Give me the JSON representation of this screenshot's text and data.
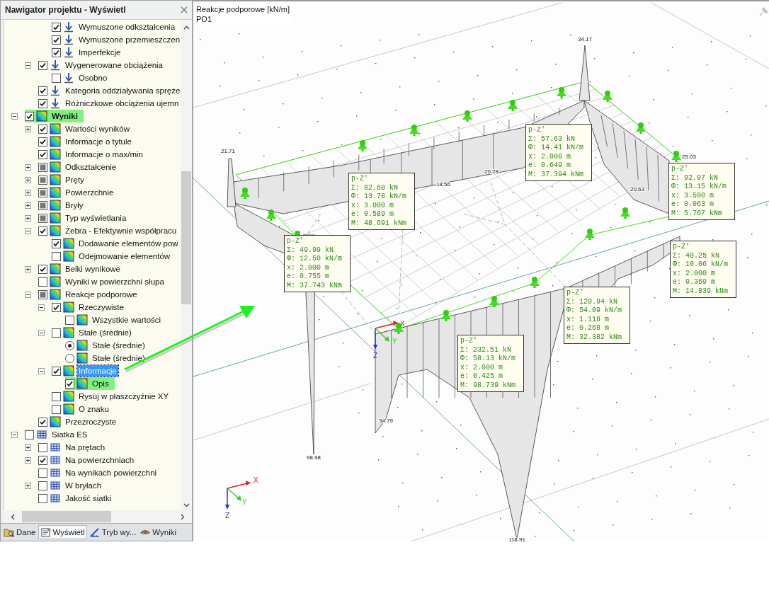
{
  "navigator": {
    "title": "Nawigator projektu - Wyświetl"
  },
  "tree": [
    {
      "children": [
        {
          "children": [
            {
              "label": "Wymuszone odkształcenia",
              "kind": "checkbox",
              "checked": true,
              "selected": false,
              "highlighted": false
            },
            {
              "label": "Wymuszone przemieszczen",
              "kind": "checkbox",
              "checked": true,
              "selected": false,
              "highlighted": false
            },
            {
              "label": "Imperfekcje",
              "kind": "checkbox",
              "checked": true,
              "selected": false,
              "highlighted": false
            }
          ]
        },
        {
          "label": "Wygenerowane obciążenia",
          "kind": "checkbox",
          "checked": true,
          "selected": false,
          "highlighted": false,
          "expanded": true,
          "children": [
            {
              "label": "Osobno",
              "kind": "checkbox",
              "checked": false,
              "selected": false,
              "highlighted": false
            }
          ]
        },
        {
          "label": "Kategoria oddziaływania spręże",
          "kind": "checkbox",
          "checked": true,
          "selected": false,
          "highlighted": false
        },
        {
          "label": "Różniczkowe obciążenia ujemn",
          "kind": "checkbox",
          "checked": true,
          "selected": false,
          "highlighted": false
        }
      ]
    },
    {
      "label": "Wyniki",
      "bold": true,
      "kind": "checkbox",
      "checked": true,
      "selected": false,
      "highlighted": true,
      "expanded": true,
      "children": [
        {
          "label": "Wartości wyników",
          "kind": "checkbox",
          "checked": true,
          "selected": false,
          "highlighted": false,
          "expanded": false
        },
        {
          "label": "Informacje o tytule",
          "kind": "checkbox",
          "checked": true,
          "selected": false,
          "highlighted": false
        },
        {
          "label": "Informacje o max/min",
          "kind": "checkbox",
          "checked": true,
          "selected": false,
          "highlighted": false
        },
        {
          "label": "Odkształcenie",
          "kind": "checkbox",
          "checked": false,
          "partial": true,
          "selected": false,
          "highlighted": false,
          "expanded": false
        },
        {
          "label": "Pręty",
          "kind": "checkbox",
          "checked": false,
          "partial": true,
          "selected": false,
          "highlighted": false,
          "expanded": false
        },
        {
          "label": "Powierzchnie",
          "kind": "checkbox",
          "checked": false,
          "partial": true,
          "selected": false,
          "highlighted": false,
          "expanded": false
        },
        {
          "label": "Bryły",
          "kind": "checkbox",
          "checked": false,
          "partial": true,
          "selected": false,
          "highlighted": false,
          "expanded": false
        },
        {
          "label": "Typ wyświetlania",
          "kind": "checkbox",
          "checked": false,
          "partial": true,
          "selected": false,
          "highlighted": false,
          "expanded": false
        },
        {
          "label": "Żebra - Efektywnie współpracu",
          "kind": "checkbox",
          "checked": true,
          "selected": false,
          "highlighted": false,
          "expanded": true,
          "children": [
            {
              "label": "Dodawanie elementów pow",
              "kind": "checkbox",
              "checked": true,
              "selected": false,
              "highlighted": false
            },
            {
              "label": "Odejmowanie elementów",
              "kind": "checkbox",
              "checked": false,
              "selected": false,
              "highlighted": false
            }
          ]
        },
        {
          "label": "Belki wynikowe",
          "kind": "checkbox",
          "checked": true,
          "selected": false,
          "highlighted": false,
          "expanded": false
        },
        {
          "label": "Wyniki w powierzchni słupa",
          "kind": "checkbox",
          "checked": false,
          "selected": false,
          "highlighted": false
        },
        {
          "label": "Reakcje podporowe",
          "kind": "checkbox",
          "checked": false,
          "partial": true,
          "selected": false,
          "highlighted": false,
          "expanded": true,
          "children": [
            {
              "label": "Rzeczywiste",
              "kind": "checkbox",
              "checked": true,
              "selected": false,
              "highlighted": false,
              "expanded": true,
              "children": [
                {
                  "label": "Wszystkie wartości",
                  "kind": "checkbox",
                  "checked": false,
                  "selected": false,
                  "highlighted": false
                }
              ]
            },
            {
              "label": "Stałe (średnie)",
              "kind": "checkbox",
              "checked": false,
              "selected": false,
              "highlighted": false,
              "expanded": true,
              "children": [
                {
                  "label": "Stałe (średnie)",
                  "kind": "radio",
                  "checked": true,
                  "selected": false,
                  "highlighted": false
                },
                {
                  "label": "Stałe (średnie)",
                  "kind": "radio",
                  "checked": false,
                  "selected": false,
                  "highlighted": false
                }
              ]
            },
            {
              "label": "Informacje",
              "kind": "checkbox",
              "checked": true,
              "selected": true,
              "highlighted": false,
              "expanded": true,
              "children": [
                {
                  "label": "Opis",
                  "kind": "checkbox",
                  "checked": true,
                  "selected": false,
                  "highlighted": true
                }
              ]
            },
            {
              "label": "Rysuj w płaszczyźnie XY",
              "kind": "checkbox",
              "checked": false,
              "selected": false,
              "highlighted": false
            },
            {
              "label": "O znaku",
              "kind": "checkbox",
              "checked": false,
              "selected": false,
              "highlighted": false
            }
          ]
        },
        {
          "label": "Przezroczyste",
          "kind": "checkbox",
          "checked": true,
          "selected": false,
          "highlighted": false
        }
      ]
    },
    {
      "label": "Siatka ES",
      "kind": "checkbox",
      "checked": false,
      "selected": false,
      "highlighted": false,
      "expanded": true,
      "children": [
        {
          "label": "Na prętach",
          "kind": "checkbox",
          "checked": false,
          "selected": false,
          "highlighted": false,
          "expanded": false
        },
        {
          "label": "Na powierzchniach",
          "kind": "checkbox",
          "checked": true,
          "selected": false,
          "highlighted": false,
          "expanded": false
        },
        {
          "label": "Na wynikach powierzchni",
          "kind": "checkbox",
          "checked": false,
          "selected": false,
          "highlighted": false
        },
        {
          "label": "W bryłach",
          "kind": "checkbox",
          "checked": false,
          "selected": false,
          "highlighted": false,
          "expanded": false
        },
        {
          "label": "Jakość siatki",
          "kind": "checkbox",
          "checked": false,
          "selected": false,
          "highlighted": false
        }
      ]
    }
  ],
  "tabs": [
    {
      "label": "Dane",
      "selected": false
    },
    {
      "label": "Wyświetl",
      "selected": true
    },
    {
      "label": "Tryb wy...",
      "selected": false
    },
    {
      "label": "Wyniki",
      "selected": false
    }
  ],
  "viewport": {
    "title": "Reakcje podporowe [kN/m]",
    "subtitle": "PO1",
    "value_labels": [
      "34.17",
      "21.71",
      "25.03",
      "20.28",
      "18.56",
      "20.63",
      "34.79",
      "98.98",
      "118.91"
    ],
    "info_boxes": [
      {
        "lines": [
          "p-Z'",
          "Σ: 57.63 kN",
          "Φ: 14.41 kN/m",
          "x: 2.000 m",
          "e: 0.649 m",
          "M: 37.394 kNm"
        ]
      },
      {
        "lines": [
          "p-Z'",
          "Σ: 92.07 kN",
          "Φ: 13.15 kN/m",
          "x: 3.500 m",
          "e: 0.063 m",
          "M: 5.767 kNm"
        ]
      },
      {
        "lines": [
          "p-Z'",
          "Σ: 82.68 kN",
          "Φ: 13.78 kN/m",
          "x: 3.000 m",
          "e: 0.589 m",
          "M: 48.691 kNm"
        ]
      },
      {
        "lines": [
          "p-Z'",
          "Σ: 49.99 kN",
          "Φ: 12.50 kN/m",
          "x: 2.000 m",
          "e: 0.755 m",
          "M: 37.743 kNm"
        ]
      },
      {
        "lines": [
          "p-Z'",
          "Σ: 40.25 kN",
          "Φ: 10.06 kN/m",
          "x: 2.000 m",
          "e: 0.369 m",
          "M: 14.839 kNm"
        ]
      },
      {
        "lines": [
          "p-Z'",
          "Σ: 120.94 kN",
          "Φ: 54.09 kN/m",
          "x: 1.118 m",
          "e: 0.268 m",
          "M: 32.382 kNm"
        ]
      },
      {
        "lines": [
          "p-Z'",
          "Σ: 232.51 kN",
          "Φ: 58.13 kN/m",
          "x: 2.000 m",
          "e: 0.425 m",
          "M: 98.739 kNm"
        ]
      }
    ],
    "origin_axes": {
      "x": "X",
      "y": "Y",
      "z": "Z"
    },
    "corner_axes": {
      "x": "X",
      "y": "Y",
      "z": "Z"
    }
  }
}
